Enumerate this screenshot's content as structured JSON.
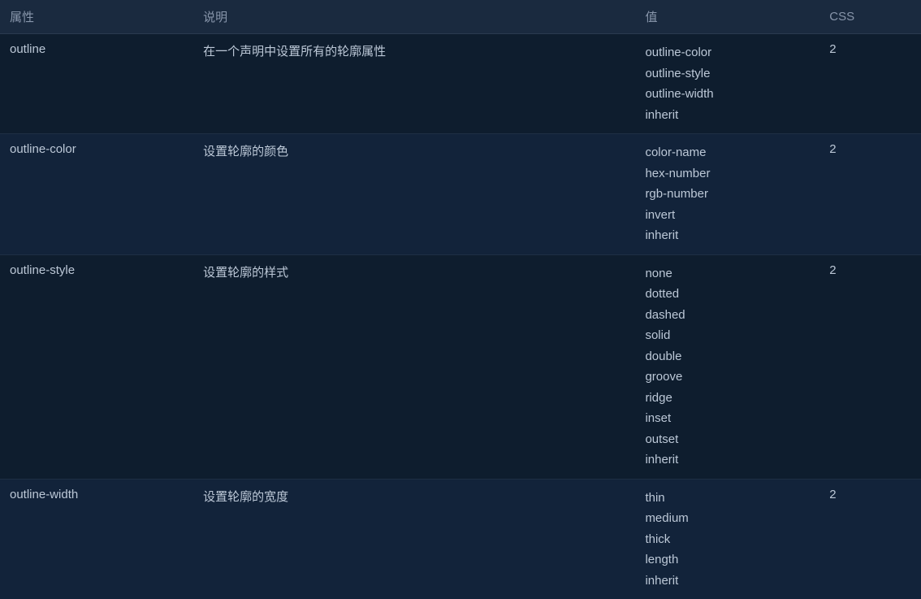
{
  "headers": {
    "attr": "属性",
    "desc": "说明",
    "val": "值",
    "css": "CSS"
  },
  "rows": [
    {
      "attr": "outline",
      "desc": "在一个声明中设置所有的轮廓属性",
      "values": [
        "outline-color",
        "outline-style",
        "outline-width",
        "inherit"
      ],
      "css": "2"
    },
    {
      "attr": "outline-color",
      "desc": "设置轮廓的颜色",
      "values": [
        "color-name",
        "hex-number",
        "rgb-number",
        "invert",
        "inherit"
      ],
      "css": "2"
    },
    {
      "attr": "outline-style",
      "desc": "设置轮廓的样式",
      "values": [
        "none",
        "dotted",
        "dashed",
        "solid",
        "double",
        "groove",
        "ridge",
        "inset",
        "outset",
        "inherit"
      ],
      "css": "2"
    },
    {
      "attr": "outline-width",
      "desc": "设置轮廓的宽度",
      "values": [
        "thin",
        "medium",
        "thick",
        "length",
        "inherit"
      ],
      "css": "2"
    }
  ]
}
